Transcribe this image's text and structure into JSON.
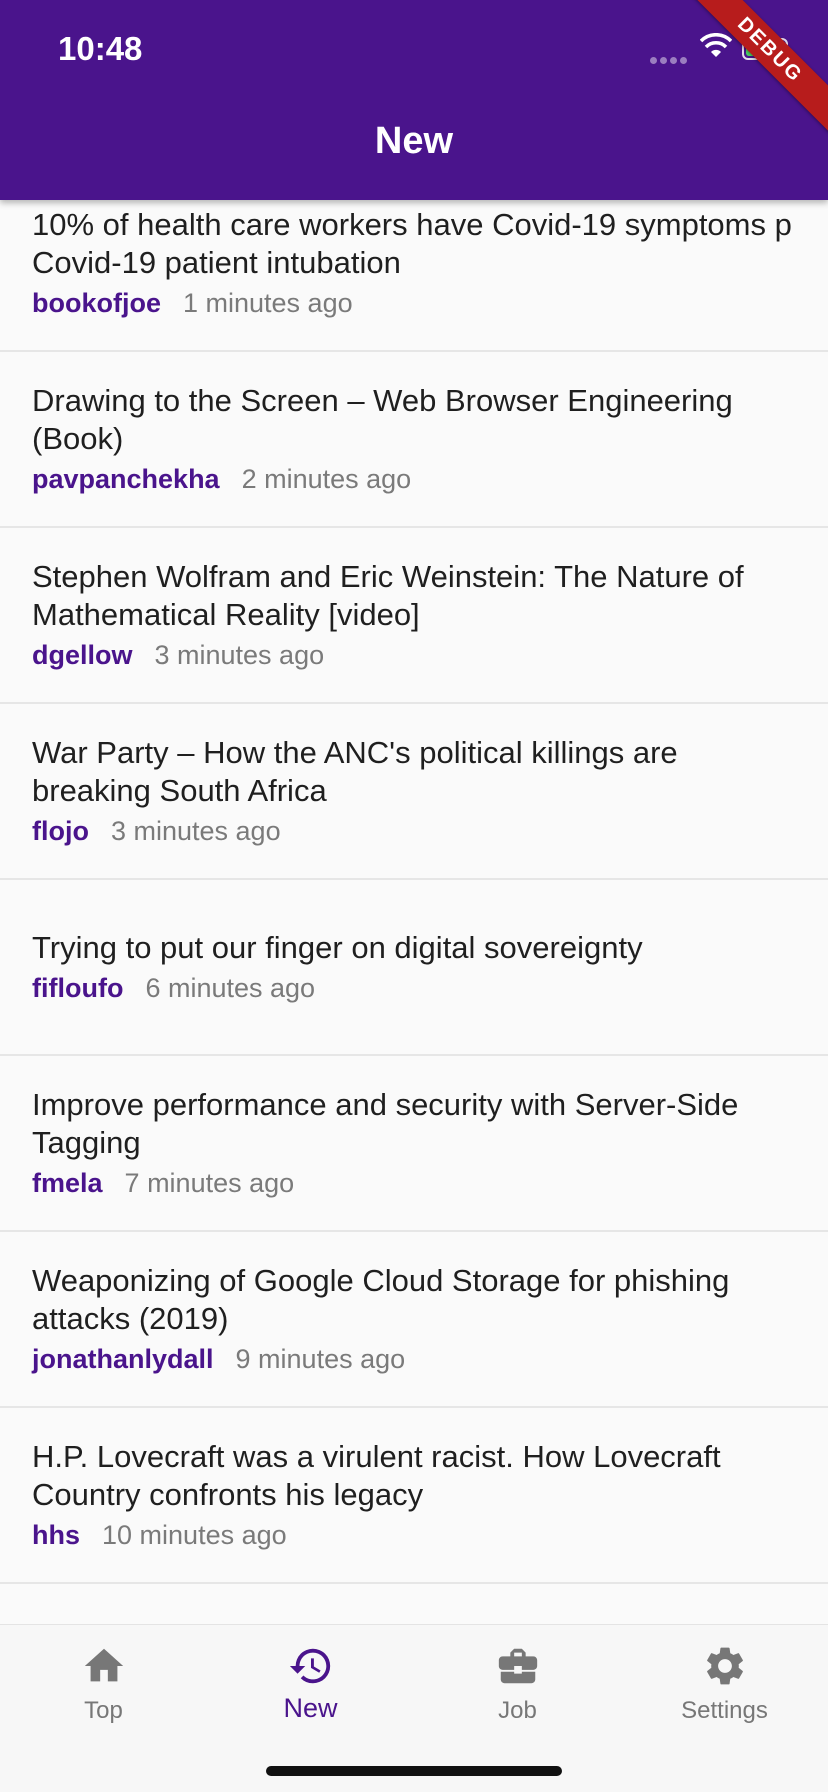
{
  "status_bar": {
    "time": "10:48"
  },
  "app_bar": {
    "title": "New",
    "debug_label": "DEBUG"
  },
  "colors": {
    "primary": "#4a148c",
    "debug": "#b71c1c",
    "battery": "#4cd964"
  },
  "stories": [
    {
      "title": "10% of health care workers have Covid-19 symptoms p Covid-19 patient intubation",
      "author": "bookofjoe",
      "time": "1 minutes ago"
    },
    {
      "title": "Drawing to the Screen – Web Browser Engineering (Book)",
      "author": "pavpanchekha",
      "time": "2 minutes ago"
    },
    {
      "title": "Stephen Wolfram and Eric Weinstein: The Nature of Mathematical Reality [video]",
      "author": "dgellow",
      "time": "3 minutes ago"
    },
    {
      "title": "War Party – How the ANC's political killings are breaking South Africa",
      "author": "flojo",
      "time": "3 minutes ago"
    },
    {
      "title": "Trying to put our finger on digital sovereignty",
      "author": "fifloufo",
      "time": "6 minutes ago"
    },
    {
      "title": "Improve performance and security with Server-Side Tagging",
      "author": "fmela",
      "time": "7 minutes ago"
    },
    {
      "title": "Weaponizing of Google Cloud Storage for phishing attacks (2019)",
      "author": "jonathanlydall",
      "time": "9 minutes ago"
    },
    {
      "title": "H.P. Lovecraft was a virulent racist. How Lovecraft Country confronts his legacy",
      "author": "hhs",
      "time": "10 minutes ago"
    }
  ],
  "bottom_nav": [
    {
      "label": "Top",
      "icon": "home-icon"
    },
    {
      "label": "New",
      "icon": "history-icon",
      "active": true
    },
    {
      "label": "Job",
      "icon": "briefcase-icon"
    },
    {
      "label": "Settings",
      "icon": "gear-icon"
    }
  ]
}
